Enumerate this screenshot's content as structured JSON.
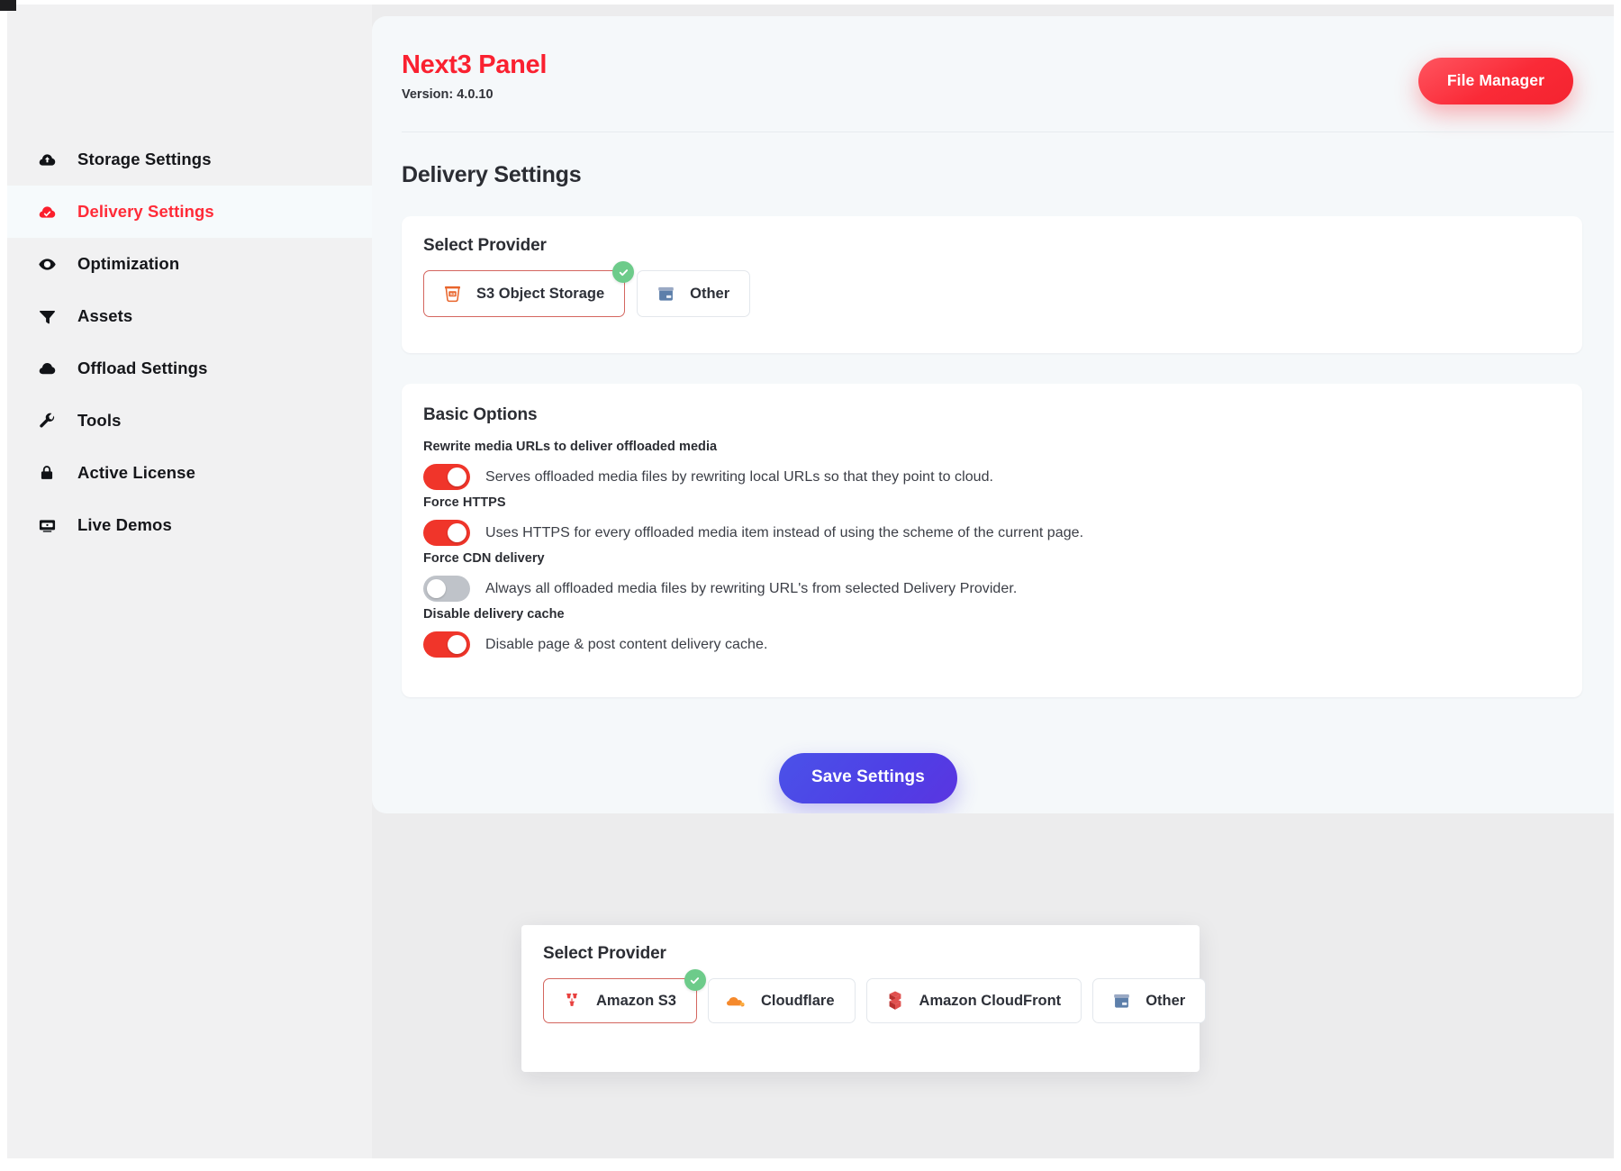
{
  "sidebar": {
    "items": [
      {
        "label": "Storage Settings",
        "icon": "cloud-upload-icon",
        "active": false
      },
      {
        "label": "Delivery Settings",
        "icon": "cloud-check-icon",
        "active": true
      },
      {
        "label": "Optimization",
        "icon": "eye-icon",
        "active": false
      },
      {
        "label": "Assets",
        "icon": "funnel-icon",
        "active": false
      },
      {
        "label": "Offload Settings",
        "icon": "cloud-icon",
        "active": false
      },
      {
        "label": "Tools",
        "icon": "wrench-icon",
        "active": false
      },
      {
        "label": "Active License",
        "icon": "lock-icon",
        "active": false
      },
      {
        "label": "Live Demos",
        "icon": "monitor-icon",
        "active": false
      }
    ]
  },
  "header": {
    "app_title": "Next3 Panel",
    "version": "Version: 4.0.10",
    "file_manager_label": "File Manager"
  },
  "page": {
    "title": "Delivery Settings"
  },
  "provider_card": {
    "title": "Select Provider",
    "options": [
      {
        "label": "S3 Object Storage",
        "icon": "s3-bucket-icon",
        "selected": true
      },
      {
        "label": "Other",
        "icon": "archive-box-icon",
        "selected": false
      }
    ]
  },
  "basic_options": {
    "title": "Basic Options",
    "rows": [
      {
        "label": "Rewrite media URLs to deliver offloaded media",
        "description": "Serves offloaded media files by rewriting local URLs so that they point to cloud.",
        "enabled": true
      },
      {
        "label": "Force HTTPS",
        "description": "Uses HTTPS for every offloaded media item instead of using the scheme of the current page.",
        "enabled": true
      },
      {
        "label": "Force CDN delivery",
        "description": "Always all offloaded media files by rewriting URL's from selected Delivery Provider.",
        "enabled": false
      },
      {
        "label": "Disable delivery cache",
        "description": "Disable page & post content delivery cache.",
        "enabled": true
      }
    ]
  },
  "save_button": {
    "label": "Save Settings"
  },
  "float_provider_card": {
    "title": "Select Provider",
    "options": [
      {
        "label": "Amazon S3",
        "icon": "amazon-s3-icon",
        "selected": true
      },
      {
        "label": "Cloudflare",
        "icon": "cloudflare-icon",
        "selected": false
      },
      {
        "label": "Amazon CloudFront",
        "icon": "amazon-cloudfront-icon",
        "selected": false
      },
      {
        "label": "Other",
        "icon": "archive-box-icon",
        "selected": false
      }
    ]
  },
  "colors": {
    "brand_red": "#fa2130",
    "toggle_on": "#f0352a",
    "toggle_off": "#bfc3c9",
    "save_blue": "#4f3fe6",
    "check_green": "#6dcb8a",
    "selected_border": "#d4665f"
  }
}
